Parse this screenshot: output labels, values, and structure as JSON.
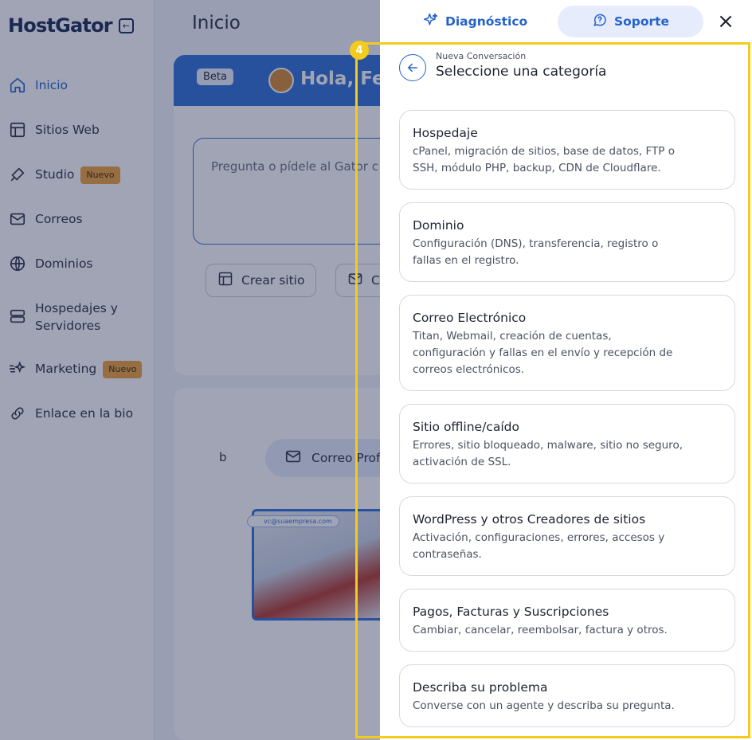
{
  "sidebar": {
    "logo": "HostGator",
    "items": [
      {
        "label": "Inicio",
        "icon": "home-icon",
        "active": true
      },
      {
        "label": "Sitios Web",
        "icon": "layout-icon"
      },
      {
        "label": "Studio",
        "icon": "brush-icon",
        "badge": "Nuevo"
      },
      {
        "label": "Correos",
        "icon": "mail-icon"
      },
      {
        "label": "Dominios",
        "icon": "globe-icon"
      },
      {
        "label": "Hospedajes y Servidores",
        "icon": "server-icon"
      },
      {
        "label": "Marketing",
        "icon": "sparkle-icon",
        "badge": "Nuevo"
      },
      {
        "label": "Enlace en la bio",
        "icon": "link-icon"
      }
    ]
  },
  "main": {
    "title": "Inicio",
    "ai_card": {
      "beta": "Beta",
      "greeting": "Hola, Fel",
      "placeholder": "Pregunta o pídele al Gator c",
      "chips": [
        "Crear sitio",
        "C"
      ]
    },
    "mail_card": {
      "left_label": "b",
      "pill_label": "Correo Prof",
      "photo_tag": "vc@suaempresa.com"
    }
  },
  "panel": {
    "tabs": {
      "diagnostico": "Diagnóstico",
      "soporte": "Soporte"
    },
    "header": {
      "subtitle": "Nueva Conversación",
      "title": "Seleccione una categoría"
    },
    "categories": [
      {
        "title": "Hospedaje",
        "desc": "cPanel, migración de sitios, base de datos, FTP o SSH, módulo PHP, backup, CDN de Cloudflare."
      },
      {
        "title": "Dominio",
        "desc": "Configuración (DNS), transferencia, registro o fallas en el registro."
      },
      {
        "title": "Correo Electrónico",
        "desc": "Titan, Webmail, creación de cuentas, configuración y fallas en el envío y recepción de correos electrónicos."
      },
      {
        "title": "Sitio offline/caído",
        "desc": "Errores, sitio bloqueado, malware, sitio no seguro, activación de SSL."
      },
      {
        "title": "WordPress y otros Creadores de sitios",
        "desc": "Activación, configuraciones, errores, accesos y contraseñas."
      },
      {
        "title": "Pagos, Facturas y Suscripciones",
        "desc": "Cambiar, cancelar, reembolsar, factura y otros."
      },
      {
        "title": "Describa su problema",
        "desc": "Converse con un agente y describa su pregunta."
      }
    ]
  },
  "highlight": {
    "number": "4",
    "color": "#f2cb1d"
  },
  "colors": {
    "primary": "#2563c9",
    "badge": "#f0a23a",
    "overlay": "rgba(28,37,78,0.42)"
  }
}
